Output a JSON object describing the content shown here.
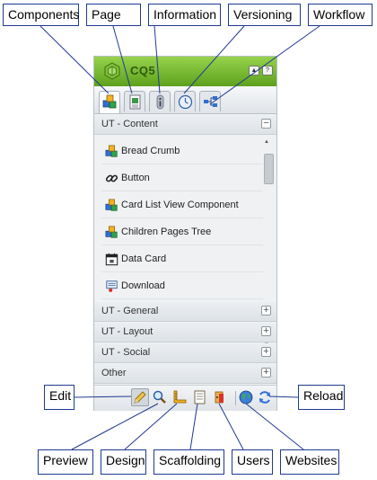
{
  "callouts": {
    "components": "Components",
    "page": "Page",
    "information": "Information",
    "versioning": "Versioning",
    "workflow": "Workflow",
    "edit": "Edit",
    "reload": "Reload",
    "preview": "Preview",
    "design": "Design",
    "scaffolding": "Scaffolding",
    "users": "Users",
    "websites": "Websites"
  },
  "sidekick": {
    "title": "CQ5",
    "title_bar_buttons": [
      "collapse",
      "help"
    ],
    "tabs": [
      {
        "icon": "components-icon",
        "active": true
      },
      {
        "icon": "page-icon",
        "active": false
      },
      {
        "icon": "information-icon",
        "active": false
      },
      {
        "icon": "versioning-icon",
        "active": false
      },
      {
        "icon": "workflow-icon",
        "active": false
      }
    ],
    "groups": [
      {
        "label": "UT - Content",
        "toggle": "−",
        "expanded": true
      },
      {
        "label": "UT - General",
        "toggle": "+",
        "expanded": false
      },
      {
        "label": "UT - Layout",
        "toggle": "+",
        "expanded": false
      },
      {
        "label": "UT - Social",
        "toggle": "+",
        "expanded": false
      },
      {
        "label": "Other",
        "toggle": "+",
        "expanded": false
      }
    ],
    "components": [
      {
        "label": "Bread Crumb",
        "icon": "component-cubes-icon"
      },
      {
        "label": "Button",
        "icon": "link-icon"
      },
      {
        "label": "Card List View Component",
        "icon": "component-cubes-icon"
      },
      {
        "label": "Children Pages Tree",
        "icon": "component-cubes-icon"
      },
      {
        "label": "Data Card",
        "icon": "calendar-icon"
      },
      {
        "label": "Download",
        "icon": "download-icon"
      }
    ],
    "scroll_up": "▲",
    "scroll_down": "▼",
    "toolbar": [
      "edit-icon",
      "preview-icon",
      "design-icon",
      "scaffolding-icon",
      "users-icon",
      "websites-icon",
      "reload-icon"
    ]
  }
}
